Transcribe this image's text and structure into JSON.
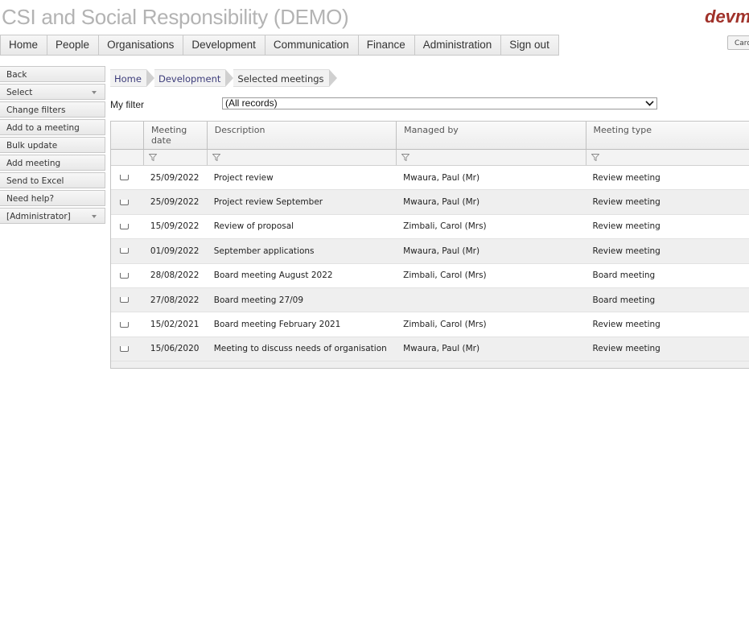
{
  "app": {
    "title": "CSI and Social Responsibility (DEMO)",
    "brand": "devm",
    "top_right_button": "Card"
  },
  "menu": [
    {
      "label": "Home"
    },
    {
      "label": "People"
    },
    {
      "label": "Organisations"
    },
    {
      "label": "Development"
    },
    {
      "label": "Communication"
    },
    {
      "label": "Finance"
    },
    {
      "label": "Administration"
    },
    {
      "label": "Sign out"
    }
  ],
  "sidebar": [
    {
      "label": "Back",
      "dropdown": false
    },
    {
      "label": "Select",
      "dropdown": true
    },
    {
      "label": "Change filters",
      "dropdown": false
    },
    {
      "label": "Add to a meeting",
      "dropdown": false
    },
    {
      "label": "Bulk update",
      "dropdown": false
    },
    {
      "label": "Add meeting",
      "dropdown": false
    },
    {
      "label": "Send to Excel",
      "dropdown": false
    },
    {
      "label": "Need help?",
      "dropdown": false
    },
    {
      "label": "[Administrator]",
      "dropdown": true
    }
  ],
  "breadcrumb": [
    {
      "label": "Home"
    },
    {
      "label": "Development"
    },
    {
      "label": "Selected meetings"
    }
  ],
  "filter": {
    "label": "My filter",
    "selected": "(All records)"
  },
  "table": {
    "columns": [
      "Meeting date",
      "Description",
      "Managed by",
      "Meeting type"
    ],
    "rows": [
      {
        "date": "25/09/2022",
        "description": "Project review",
        "managed_by": "Mwaura, Paul (Mr)",
        "type": "Review meeting"
      },
      {
        "date": "25/09/2022",
        "description": "Project review September",
        "managed_by": "Mwaura, Paul (Mr)",
        "type": "Review meeting"
      },
      {
        "date": "15/09/2022",
        "description": "Review of proposal",
        "managed_by": "Zimbali, Carol (Mrs)",
        "type": "Review meeting"
      },
      {
        "date": "01/09/2022",
        "description": "September applications",
        "managed_by": "Mwaura, Paul (Mr)",
        "type": "Review meeting"
      },
      {
        "date": "28/08/2022",
        "description": "Board meeting August 2022",
        "managed_by": "Zimbali, Carol (Mrs)",
        "type": "Board meeting"
      },
      {
        "date": "27/08/2022",
        "description": "Board meeting 27/09",
        "managed_by": "",
        "type": "Board meeting"
      },
      {
        "date": "15/02/2021",
        "description": "Board meeting February 2021",
        "managed_by": "Zimbali, Carol (Mrs)",
        "type": "Review meeting"
      },
      {
        "date": "15/06/2020",
        "description": "Meeting to discuss needs of organisation",
        "managed_by": "Mwaura, Paul (Mr)",
        "type": "Review meeting"
      }
    ]
  }
}
